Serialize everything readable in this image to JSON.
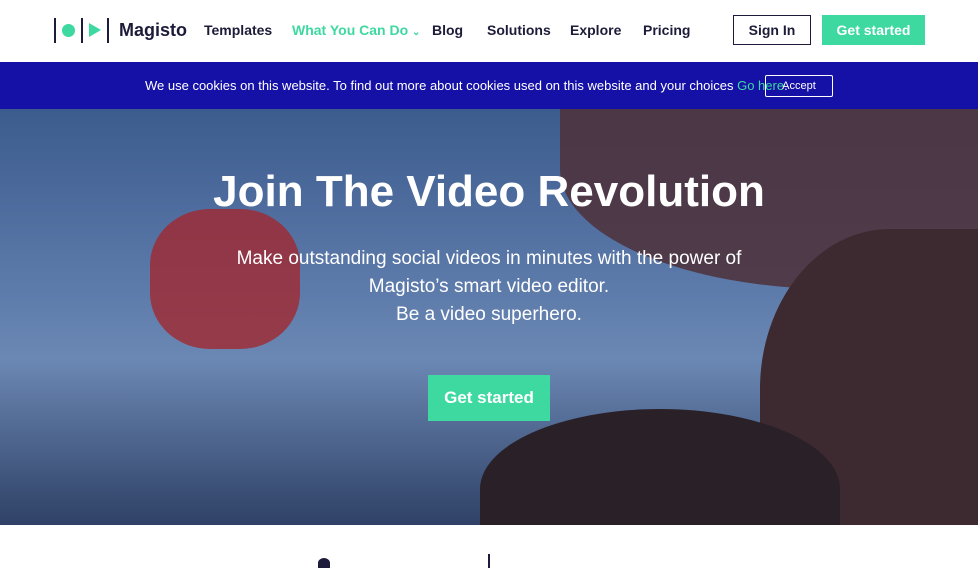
{
  "nav": {
    "brand": "Magisto",
    "items": [
      {
        "label": "Templates"
      },
      {
        "label": "What You Can Do"
      },
      {
        "label": "Blog"
      },
      {
        "label": "Solutions"
      },
      {
        "label": "Explore"
      },
      {
        "label": "Pricing"
      }
    ],
    "sign_in": "Sign In",
    "get_started": "Get started",
    "accent": "#3dd9a0"
  },
  "cookie": {
    "message": "We use cookies on this website. To find out more about cookies used on this website and your choices ",
    "link": "Go here",
    "end": ".",
    "accept": "Accept",
    "bg": "#1511a6"
  },
  "hero": {
    "title": "Join The Video Revolution",
    "line1": "Make outstanding social videos in minutes with the power of",
    "line2": "Magisto’s smart video editor.",
    "line3": "Be a video superhero.",
    "cta": "Get started"
  }
}
